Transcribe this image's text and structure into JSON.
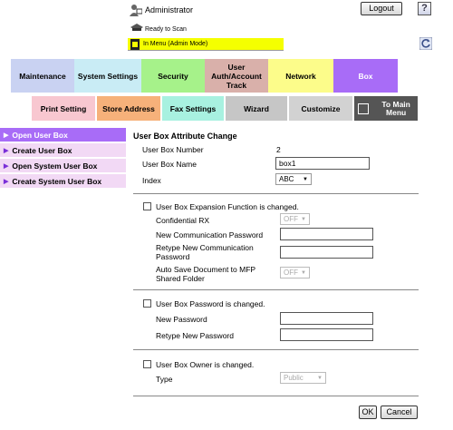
{
  "header": {
    "user": "Administrator",
    "logout_label": "Logout",
    "help_label": "?",
    "status": "Ready to Scan",
    "mode": "In Menu (Admin Mode)",
    "mode_color": "#f5ff00"
  },
  "tabs": {
    "maintenance": "Maintenance",
    "system_settings": "System Settings",
    "security": "Security",
    "user_auth": "User Auth/Account Track",
    "network": "Network",
    "box": "Box"
  },
  "subtabs": {
    "print_setting": "Print Setting",
    "store_address": "Store Address",
    "fax_settings": "Fax Settings",
    "wizard": "Wizard",
    "customize": "Customize",
    "to_main_menu": "To Main Menu"
  },
  "sidebar": {
    "items": [
      {
        "label": "Open User Box",
        "active": true
      },
      {
        "label": "Create User Box",
        "active": false
      },
      {
        "label": "Open System User Box",
        "active": false
      },
      {
        "label": "Create System User Box",
        "active": false
      }
    ]
  },
  "form": {
    "title": "User Box Attribute Change",
    "number_label": "User Box Number",
    "number_value": "2",
    "name_label": "User Box Name",
    "name_value": "box1",
    "index_label": "Index",
    "index_value": "ABC",
    "expansion_label": "User Box Expansion Function is changed.",
    "confidential_label": "Confidential RX",
    "confidential_value": "OFF",
    "new_comm_pw_label": "New Communication Password",
    "retype_comm_pw_label": "Retype New Communication Password",
    "autosave_label": "Auto Save Document to MFP Shared Folder",
    "autosave_value": "OFF",
    "password_change_label": "User Box Password is changed.",
    "new_password_label": "New Password",
    "retype_password_label": "Retype New Password",
    "owner_change_label": "User Box Owner is changed.",
    "type_label": "Type",
    "type_value": "Public",
    "ok_label": "OK",
    "cancel_label": "Cancel"
  }
}
